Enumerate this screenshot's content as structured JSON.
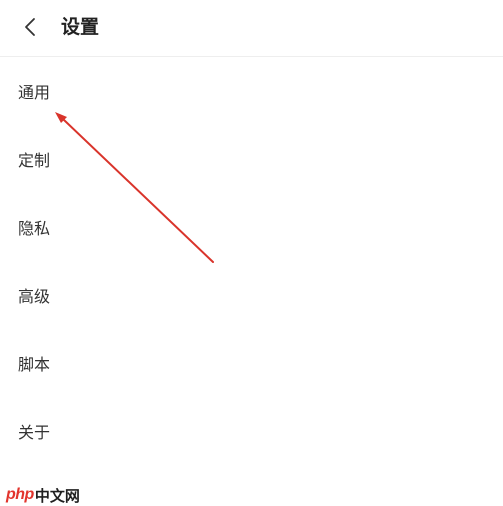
{
  "header": {
    "back_icon": "chevron-left-icon",
    "title": "设置"
  },
  "menu": {
    "items": [
      {
        "label": "通用"
      },
      {
        "label": "定制"
      },
      {
        "label": "隐私"
      },
      {
        "label": "高级"
      },
      {
        "label": "脚本"
      },
      {
        "label": "关于"
      }
    ]
  },
  "annotation": {
    "type": "arrow",
    "color": "#d9342b",
    "points_to": "通用"
  },
  "watermark": {
    "brand": "php",
    "text": "中文网"
  }
}
